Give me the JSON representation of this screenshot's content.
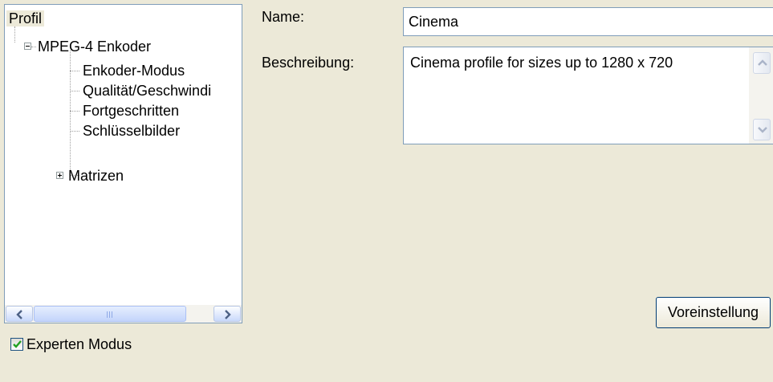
{
  "tree": {
    "root": "Profil",
    "items": [
      {
        "label": "MPEG-4 Enkoder",
        "expanded": true
      },
      {
        "label": "Enkoder-Modus"
      },
      {
        "label": "Qualität/Geschwindi"
      },
      {
        "label": "Fortgeschritten"
      },
      {
        "label": "Schlüsselbilder"
      },
      {
        "label": "Matrizen",
        "expanded": false
      }
    ],
    "scrollbar_grip": "III"
  },
  "form": {
    "name_label": "Name:",
    "name_value": "Cinema",
    "description_label": "Beschreibung:",
    "description_value": "Cinema profile for sizes up to 1280 x 720"
  },
  "buttons": {
    "preset": "Voreinstellung"
  },
  "expert_mode": {
    "label": "Experten Modus",
    "checked": true
  },
  "colors": {
    "window_bg": "#ece9d8",
    "border": "#7f9db9",
    "check": "#21a121"
  }
}
